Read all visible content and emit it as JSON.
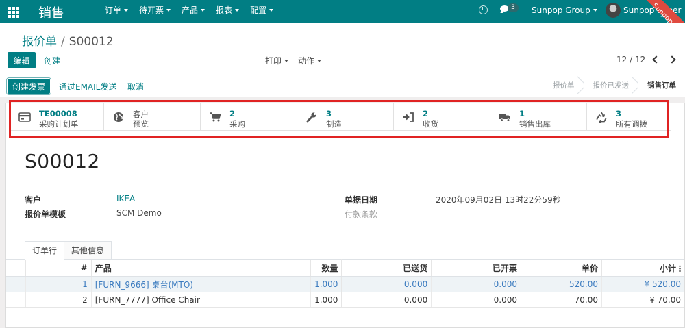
{
  "app": {
    "brand": "销售"
  },
  "nav": {
    "menu": [
      {
        "label": "订单"
      },
      {
        "label": "待开票"
      },
      {
        "label": "产品"
      },
      {
        "label": "报表"
      },
      {
        "label": "配置"
      }
    ],
    "chat_count": "3",
    "company": "Sunpop Group",
    "user": "Sunpop Super",
    "watermark": "Sunpop.cn"
  },
  "breadcrumb": {
    "parent": "报价单",
    "separator": "/",
    "current": "S00012"
  },
  "actions": {
    "edit": "编辑",
    "create": "创建",
    "print": "打印",
    "action": "动作",
    "pager": "12 / 12"
  },
  "header": {
    "create_invoice": "创建发票",
    "send_email": "通过EMAIL发送",
    "cancel": "取消",
    "stages": [
      {
        "label": "报价单",
        "current": false
      },
      {
        "label": "报价已发送",
        "current": false
      },
      {
        "label": "销售订单",
        "current": true
      }
    ]
  },
  "smart_buttons": [
    {
      "value": "TE00008",
      "label": "采购计划单",
      "icon": "card-icon"
    },
    {
      "value": "",
      "label_top": "客户",
      "label": "预览",
      "icon": "globe-icon"
    },
    {
      "value": "2",
      "label": "采购",
      "icon": "cart-icon"
    },
    {
      "value": "3",
      "label": "制造",
      "icon": "wrench-icon"
    },
    {
      "value": "2",
      "label": "收货",
      "icon": "sign-in-icon"
    },
    {
      "value": "1",
      "label": "销售出库",
      "icon": "truck-icon"
    },
    {
      "value": "3",
      "label": "所有调拨",
      "icon": "recycle-icon"
    }
  ],
  "record": {
    "name": "S00012",
    "customer_label": "客户",
    "customer": "IKEA",
    "template_label": "报价单模板",
    "template": "SCM Demo",
    "date_label": "单据日期",
    "date": "2020年09月02日 13时22分59秒",
    "payment_terms_placeholder": "付款条款"
  },
  "tabs": [
    {
      "label": "订单行",
      "active": true
    },
    {
      "label": "其他信息",
      "active": false
    }
  ],
  "lines": {
    "columns": [
      "#",
      "产品",
      "数量",
      "已送货",
      "已开票",
      "单价",
      "小计"
    ],
    "rows": [
      {
        "seq": "1",
        "product": "[FURN_9666] 桌台(MTO)",
        "qty": "1.000",
        "delivered": "0.000",
        "invoiced": "0.000",
        "price": "520.00",
        "subtotal": "¥ 520.00"
      },
      {
        "seq": "2",
        "product": "[FURN_7777] Office Chair",
        "qty": "1.000",
        "delivered": "0.000",
        "invoiced": "0.000",
        "price": "70.00",
        "subtotal": "¥ 70.00"
      }
    ]
  },
  "colors": {
    "primary": "#017e84",
    "highlight": "#e02323",
    "link": "#3b7bbf"
  }
}
